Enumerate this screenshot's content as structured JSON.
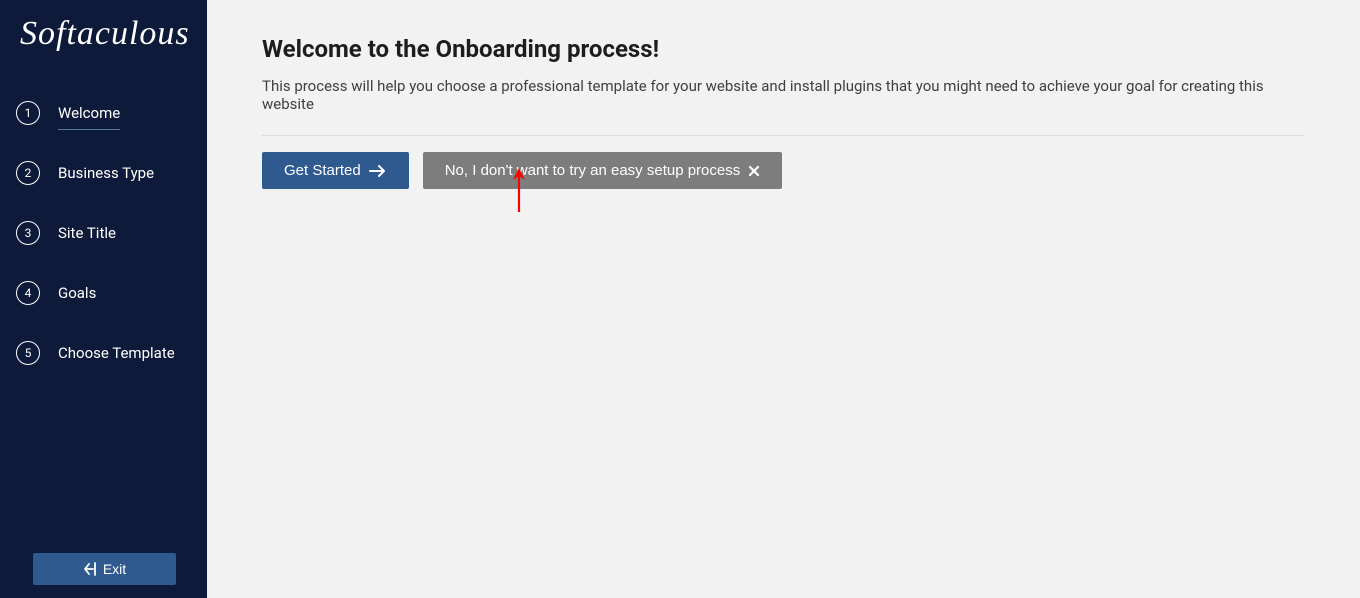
{
  "brand": {
    "name": "Softaculous"
  },
  "sidebar": {
    "items": [
      {
        "number": "1",
        "label": "Welcome",
        "active": true
      },
      {
        "number": "2",
        "label": "Business Type",
        "active": false
      },
      {
        "number": "3",
        "label": "Site Title",
        "active": false
      },
      {
        "number": "4",
        "label": "Goals",
        "active": false
      },
      {
        "number": "5",
        "label": "Choose Template",
        "active": false
      }
    ],
    "exit_label": "Exit"
  },
  "main": {
    "heading": "Welcome to the Onboarding process!",
    "subtext": "This process will help you choose a professional template for your website and install plugins that you might need to achieve your goal for creating this website",
    "get_started_label": "Get Started",
    "skip_label": "No, I don't want to try an easy setup process"
  },
  "colors": {
    "sidebar_bg": "#0e1a3a",
    "primary_button": "#2f5a8f",
    "secondary_button": "#7d7d7d",
    "annotation": "#ff0000"
  }
}
